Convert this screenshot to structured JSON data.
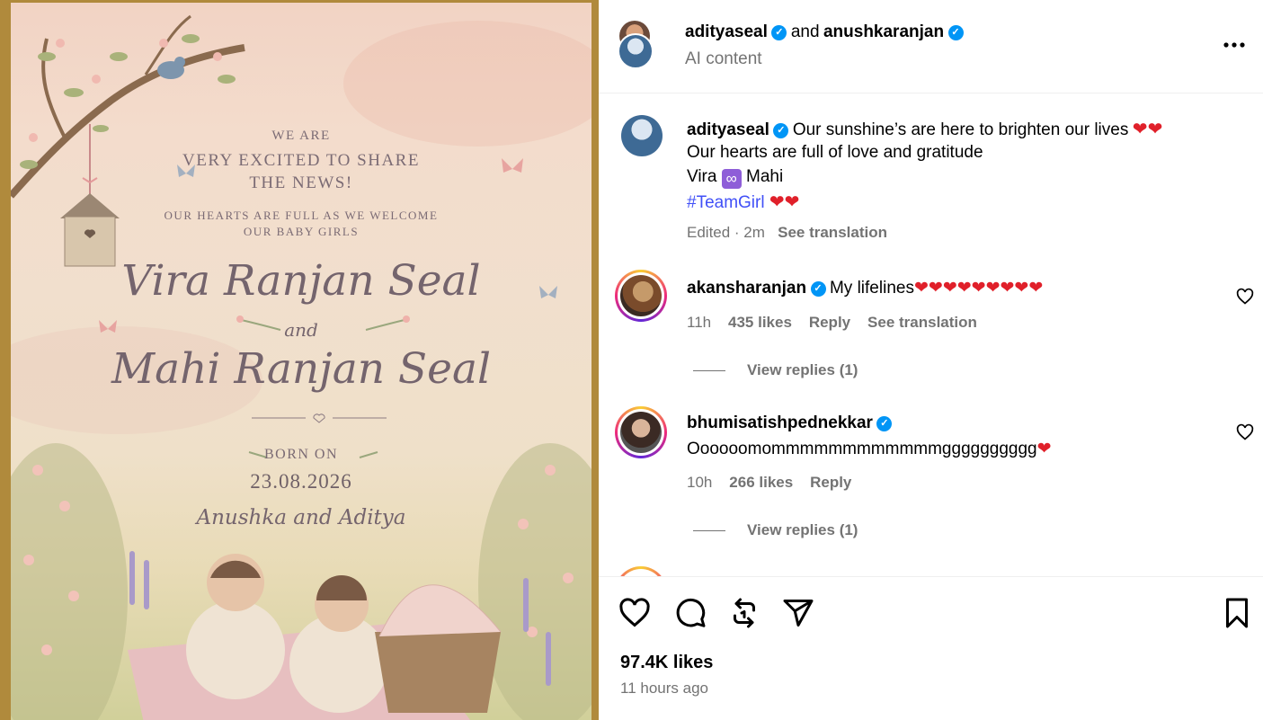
{
  "invitation": {
    "line1": "WE ARE",
    "line2": "VERY EXCITED TO SHARE",
    "line3": "THE NEWS!",
    "line4": "OUR HEARTS ARE FULL AS WE WELCOME",
    "line5": "OUR BABY GIRLS",
    "name1": "Vira Ranjan Seal",
    "and": "and",
    "name2": "Mahi Ranjan Seal",
    "born_label": "BORN ON",
    "date": "23.08.2026",
    "parents": "Anushka and Aditya"
  },
  "header": {
    "user1": "adityaseal",
    "conjunction": "and",
    "user2": "anushkaranjan",
    "subtitle": "AI content"
  },
  "caption": {
    "username": "adityaseal",
    "line1": "Our sunshine’s are here to brighten our lives",
    "line2": "Our hearts are full of love and gratitude",
    "line3_a": "Vira",
    "line3_b": "Mahi",
    "hashtag": "#TeamGirl",
    "edited": "Edited · 2m",
    "see_translation": "See translation"
  },
  "comments": [
    {
      "username": "akansharanjan",
      "text": "My lifelines",
      "heart_count": 9,
      "time": "11h",
      "likes": "435 likes",
      "reply": "Reply",
      "see_translation": "See translation",
      "view_replies": "View replies (1)"
    },
    {
      "username": "bhumisatishpednekkar",
      "text": "Oooooomommmmmmmmmmmmgggggggggg",
      "time": "10h",
      "likes": "266 likes",
      "reply": "Reply",
      "view_replies": "View replies (1)"
    }
  ],
  "footer": {
    "likes": "97.4K likes",
    "time_ago": "11 hours ago"
  },
  "icons": {
    "like": "heart-outline-icon",
    "comment": "speech-bubble-icon",
    "repost": "repost-icon",
    "share": "paper-plane-icon",
    "save": "bookmark-icon",
    "more": "more-options-icon",
    "verified": "verified-badge-icon"
  },
  "colors": {
    "verified": "#0095f6",
    "hashtag": "#4150f7",
    "heart": "#e0202a",
    "muted_text": "#737373"
  }
}
